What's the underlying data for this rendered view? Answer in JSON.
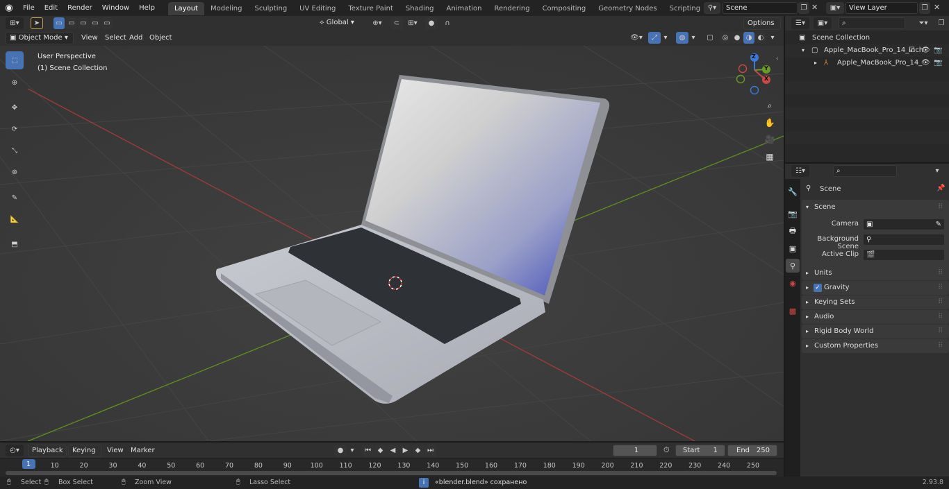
{
  "menu": {
    "items": [
      "File",
      "Edit",
      "Render",
      "Window",
      "Help"
    ],
    "workspaces": [
      "Layout",
      "Modeling",
      "Sculpting",
      "UV Editing",
      "Texture Paint",
      "Shading",
      "Animation",
      "Rendering",
      "Compositing",
      "Geometry Nodes",
      "Scripting"
    ],
    "active_workspace": "Layout",
    "add_tab": "+",
    "scene_name": "Scene",
    "view_layer": "View Layer"
  },
  "viewport_header": {
    "mode": "Object Mode",
    "menus": [
      "View",
      "Select",
      "Add",
      "Object"
    ],
    "transform_orientation": "Global",
    "options": "Options"
  },
  "viewport": {
    "perspective_label": "User Perspective",
    "collection_label": "(1) Scene Collection",
    "gizmo": {
      "z": "Z",
      "y": "Y",
      "x": "X"
    }
  },
  "outliner": {
    "search_placeholder": "",
    "rows": [
      {
        "label": "Scene Collection"
      },
      {
        "label": "Apple_MacBook_Pro_14_inch"
      },
      {
        "label": "Apple_MacBook_Pro_14_"
      }
    ]
  },
  "properties": {
    "scene_label": "Scene",
    "section_title": "Scene",
    "camera_label": "Camera",
    "background_label": "Background Scene",
    "active_clip_label": "Active Clip",
    "panels": [
      "Units",
      "Gravity",
      "Keying Sets",
      "Audio",
      "Rigid Body World",
      "Custom Properties"
    ],
    "gravity_enabled": true
  },
  "timeline": {
    "menus": [
      "Playback",
      "Keying",
      "View",
      "Marker"
    ],
    "current_frame": "1",
    "start_label": "Start",
    "start_value": "1",
    "end_label": "End",
    "end_value": "250",
    "ticks": [
      "1",
      "10",
      "20",
      "30",
      "40",
      "50",
      "60",
      "70",
      "80",
      "90",
      "100",
      "110",
      "120",
      "130",
      "140",
      "150",
      "160",
      "170",
      "180",
      "190",
      "200",
      "210",
      "220",
      "230",
      "240",
      "250"
    ]
  },
  "statusbar": {
    "select": "Select",
    "box_select": "Box Select",
    "zoom_view": "Zoom View",
    "lasso_select": "Lasso Select",
    "message": "«blender.blend» сохранено",
    "version": "2.93.8"
  },
  "colors": {
    "accent": "#4772b3",
    "x_axis": "#c94848",
    "y_axis": "#6a9a28",
    "z_axis": "#3b7ad9"
  }
}
